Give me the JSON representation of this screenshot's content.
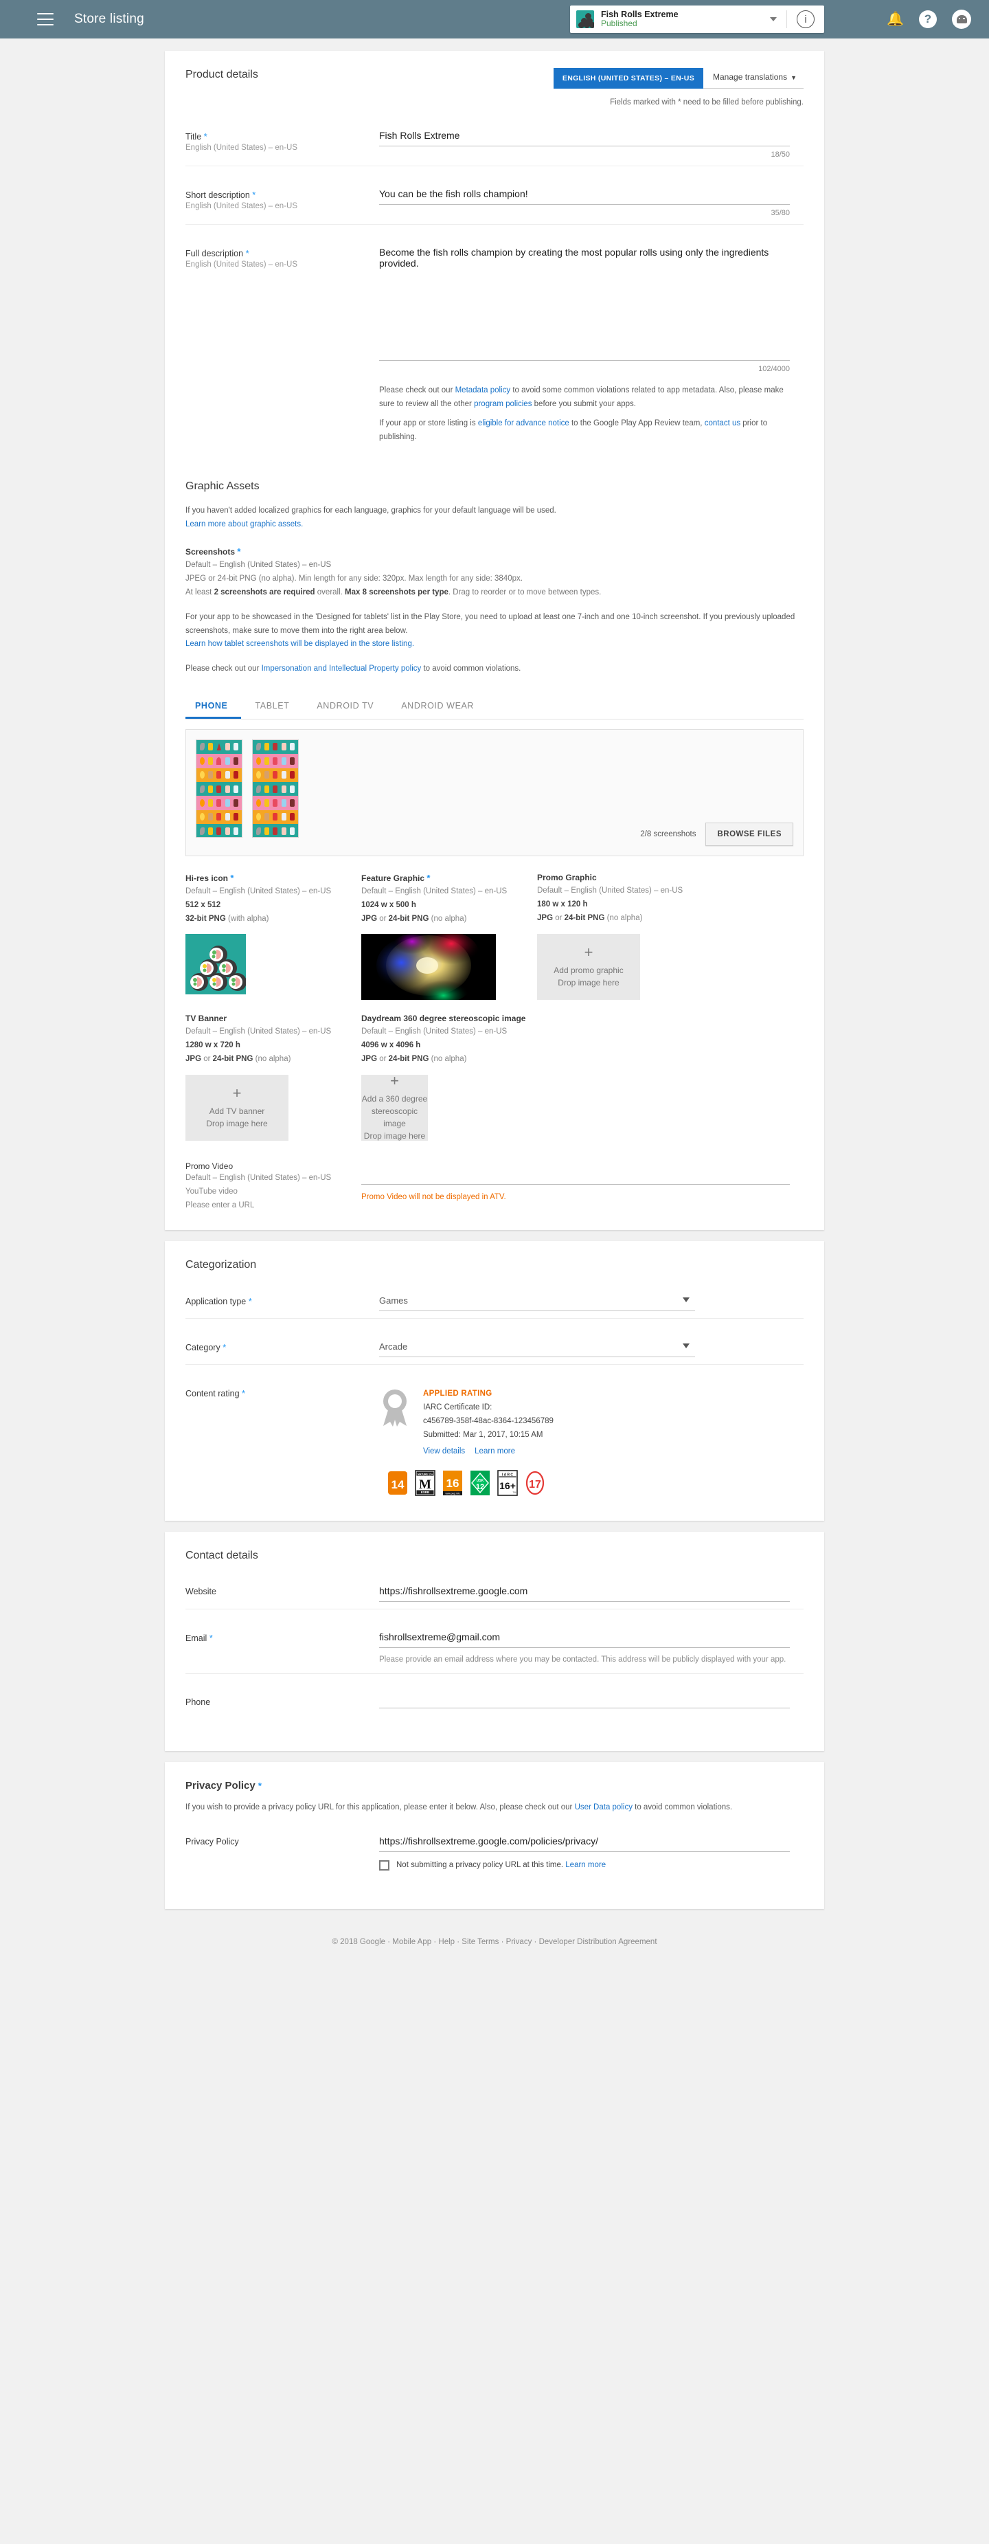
{
  "topbar": {
    "menu_icon": "hamburger-menu-icon",
    "title": "Store listing",
    "app": {
      "name": "Fish Rolls Extreme",
      "status": "Published",
      "caret_icon": "chevron-down-icon",
      "info_icon": "info-circle-icon"
    },
    "notifications_icon": "bell-icon",
    "help_icon": "question-mark-icon",
    "avatar_icon": "android-avatar-icon"
  },
  "product_details": {
    "title": "Product details",
    "language_pill": "ENGLISH (UNITED STATES) – EN-US",
    "manage_translations": "Manage translations",
    "fields_note": "Fields marked with * need to be filled before publishing.",
    "fields": [
      {
        "label": "Title",
        "required": true,
        "sublabel": "English (United States) – en-US",
        "value": "Fish Rolls Extreme",
        "counter": "18/50"
      },
      {
        "label": "Short description",
        "required": true,
        "sublabel": "English (United States) – en-US",
        "value": "You can be the fish rolls champion!",
        "counter": "35/80"
      },
      {
        "label": "Full description",
        "required": true,
        "sublabel": "English (United States) – en-US",
        "value": "Become the fish rolls champion by creating the most popular rolls using only the ingredients provided.",
        "counter": "102/4000"
      }
    ],
    "policy_note_1_a": "Please check out our ",
    "policy_note_1_link1": "Metadata policy",
    "policy_note_1_b": " to avoid some common violations related to app metadata. Also, please make sure to review all the other ",
    "policy_note_1_link2": "program policies",
    "policy_note_1_c": " before you submit your apps.",
    "policy_note_2_a": "If your app or store listing is ",
    "policy_note_2_link1": "eligible for advance notice",
    "policy_note_2_b": " to the Google Play App Review team, ",
    "policy_note_2_link2": "contact us",
    "policy_note_2_c": " prior to publishing."
  },
  "graphic_assets": {
    "title": "Graphic Assets",
    "intro": "If you haven't added localized graphics for each language, graphics for your default language will be used.",
    "intro_link": "Learn more about graphic assets.",
    "screenshots_label": "Screenshots",
    "screenshots_required": true,
    "screenshots_sub": "Default – English (United States) – en-US",
    "screenshots_spec": "JPEG or 24-bit PNG (no alpha). Min length for any side: 320px. Max length for any side: 3840px.",
    "screenshots_rule_a": "At least ",
    "screenshots_rule_b": "2 screenshots are required",
    "screenshots_rule_c": " overall. ",
    "screenshots_rule_d": "Max 8 screenshots per type",
    "screenshots_rule_e": ". Drag to reorder or to move between types.",
    "tablet_para": "For your app to be showcased in the 'Designed for tablets' list in the Play Store, you need to upload at least one 7-inch and one 10-inch screenshot. If you previously uploaded screenshots, make sure to move them into the right area below.",
    "tablet_link": "Learn how tablet screenshots will be displayed in the store listing.",
    "ip_para_a": "Please check out our ",
    "ip_link": "Impersonation and Intellectual Property policy",
    "ip_para_b": " to avoid common violations.",
    "tabs": [
      {
        "label": "PHONE",
        "active": true
      },
      {
        "label": "TABLET",
        "active": false
      },
      {
        "label": "ANDROID TV",
        "active": false
      },
      {
        "label": "ANDROID WEAR",
        "active": false
      }
    ],
    "screenshot_count": "2/8 screenshots",
    "browse_files": "BROWSE FILES",
    "assets_row1": [
      {
        "title": "Hi-res icon",
        "required": true,
        "sub": "Default – English (United States) – en-US",
        "dims": "512 x 512",
        "format_bold": "32-bit PNG",
        "format_rest": " (with alpha)",
        "state": "uploaded"
      },
      {
        "title": "Feature Graphic",
        "required": true,
        "sub": "Default – English (United States) – en-US",
        "dims": "1024 w x 500 h",
        "format_bold": "JPG",
        "format_mid": " or ",
        "format_bold2": "24-bit PNG",
        "format_rest": " (no alpha)",
        "state": "uploaded"
      },
      {
        "title": "Promo Graphic",
        "required": false,
        "sub": "Default – English (United States) – en-US",
        "dims": "180 w x 120 h",
        "format_bold": "JPG",
        "format_mid": " or ",
        "format_bold2": "24-bit PNG",
        "format_rest": " (no alpha)",
        "state": "empty",
        "drop_line1": "Add promo graphic",
        "drop_line2": "Drop image here"
      }
    ],
    "assets_row2": [
      {
        "title": "TV Banner",
        "required": false,
        "sub": "Default – English (United States) – en-US",
        "dims": "1280 w x 720 h",
        "format_bold": "JPG",
        "format_mid": " or ",
        "format_bold2": "24-bit PNG",
        "format_rest": " (no alpha)",
        "state": "empty",
        "drop_line1": "Add TV banner",
        "drop_line2": "Drop image here"
      },
      {
        "title": "Daydream 360 degree stereoscopic image",
        "required": false,
        "sub": "Default – English (United States) – en-US",
        "dims": "4096 w x 4096 h",
        "format_bold": "JPG",
        "format_mid": " or ",
        "format_bold2": "24-bit PNG",
        "format_rest": " (no alpha)",
        "state": "empty",
        "drop_line1": "Add a 360 degree",
        "drop_line2": "stereoscopic image",
        "drop_line3": "Drop image here"
      }
    ],
    "promo_video": {
      "title": "Promo Video",
      "sub1": "Default – English (United States) – en-US",
      "sub2": "YouTube video",
      "sub3": "Please enter a URL",
      "value": "",
      "warning": "Promo Video will not be displayed in ATV."
    }
  },
  "categorization": {
    "title": "Categorization",
    "application_type": {
      "label": "Application type",
      "required": true,
      "value": "Games"
    },
    "category": {
      "label": "Category",
      "required": true,
      "value": "Arcade"
    },
    "content_rating": {
      "label": "Content rating",
      "required": true,
      "applied": "APPLIED RATING",
      "cert_label": "IARC Certificate ID:",
      "cert_id": "c456789-358f-48ac-8364-123456789",
      "submitted": "Submitted: Mar 1, 2017, 10:15 AM",
      "view_details": "View details",
      "learn_more": "Learn more",
      "badges": [
        {
          "name": "classind-14-badge",
          "text": "14"
        },
        {
          "name": "esrb-mature-badge",
          "text": "M",
          "top": "MATURE 17+",
          "bottom": "ESRB"
        },
        {
          "name": "pegi-16-badge",
          "text": "16",
          "bottom": "www.pegi.info"
        },
        {
          "name": "usk-12-badge",
          "text": "12",
          "top": "USK"
        },
        {
          "name": "iarc-16-badge",
          "text": "16+",
          "top": "I A R C"
        },
        {
          "name": "age-17-badge",
          "text": "17"
        }
      ]
    }
  },
  "contact_details": {
    "title": "Contact details",
    "website": {
      "label": "Website",
      "required": false,
      "value": "https://fishrollsextreme.google.com"
    },
    "email": {
      "label": "Email",
      "required": true,
      "value": "fishrollsextreme@gmail.com",
      "hint": "Please provide an email address where you may be contacted. This address will be publicly displayed with your app."
    },
    "phone": {
      "label": "Phone",
      "required": false,
      "value": ""
    }
  },
  "privacy_policy": {
    "title": "Privacy Policy",
    "required": true,
    "desc_a": "If you wish to provide a privacy policy URL for this application, please enter it below. Also, please check out our ",
    "desc_link": "User Data policy",
    "desc_b": " to avoid common violations.",
    "field_label": "Privacy Policy",
    "value": "https://fishrollsextreme.google.com/policies/privacy/",
    "checkbox_label": "Not submitting a privacy policy URL at this time.",
    "checkbox_link": "Learn more",
    "checkbox_checked": false
  },
  "footer": {
    "copyright": "© 2018 Google",
    "links": [
      "Mobile App",
      "Help",
      "Site Terms",
      "Privacy",
      "Developer Distribution Agreement"
    ],
    "separator": " · "
  },
  "colors": {
    "topbar": "#607d8b",
    "accent_blue": "#1a73c8",
    "required_star": "#2196f3",
    "warning_orange": "#ef6c00",
    "published_green": "#4a9b52",
    "app_teal": "#26a69a"
  }
}
